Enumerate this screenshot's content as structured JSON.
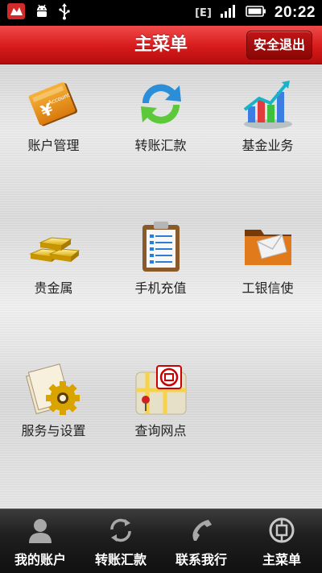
{
  "status_bar": {
    "network_type": "E",
    "time": "20:22"
  },
  "header": {
    "title": "主菜单",
    "logout_label": "安全退出"
  },
  "menu": {
    "items": [
      {
        "label": "账户管理",
        "icon": "account-book-icon"
      },
      {
        "label": "转账汇款",
        "icon": "transfer-arrows-icon"
      },
      {
        "label": "基金业务",
        "icon": "fund-chart-icon"
      },
      {
        "label": "贵金属",
        "icon": "gold-bars-icon"
      },
      {
        "label": "手机充值",
        "icon": "recharge-clipboard-icon"
      },
      {
        "label": "工银信使",
        "icon": "messenger-folder-icon"
      },
      {
        "label": "服务与设置",
        "icon": "settings-gear-icon"
      },
      {
        "label": "查询网点",
        "icon": "branch-map-icon"
      }
    ]
  },
  "bottom_nav": {
    "items": [
      {
        "label": "我的账户",
        "icon": "person-icon"
      },
      {
        "label": "转账汇款",
        "icon": "refresh-icon"
      },
      {
        "label": "联系我行",
        "icon": "phone-icon"
      },
      {
        "label": "主菜单",
        "icon": "icbc-logo-icon"
      }
    ]
  },
  "colors": {
    "header_red": "#d71b1b",
    "exit_button_red": "#a40d0d",
    "nav_background": "#1f1f1f"
  }
}
